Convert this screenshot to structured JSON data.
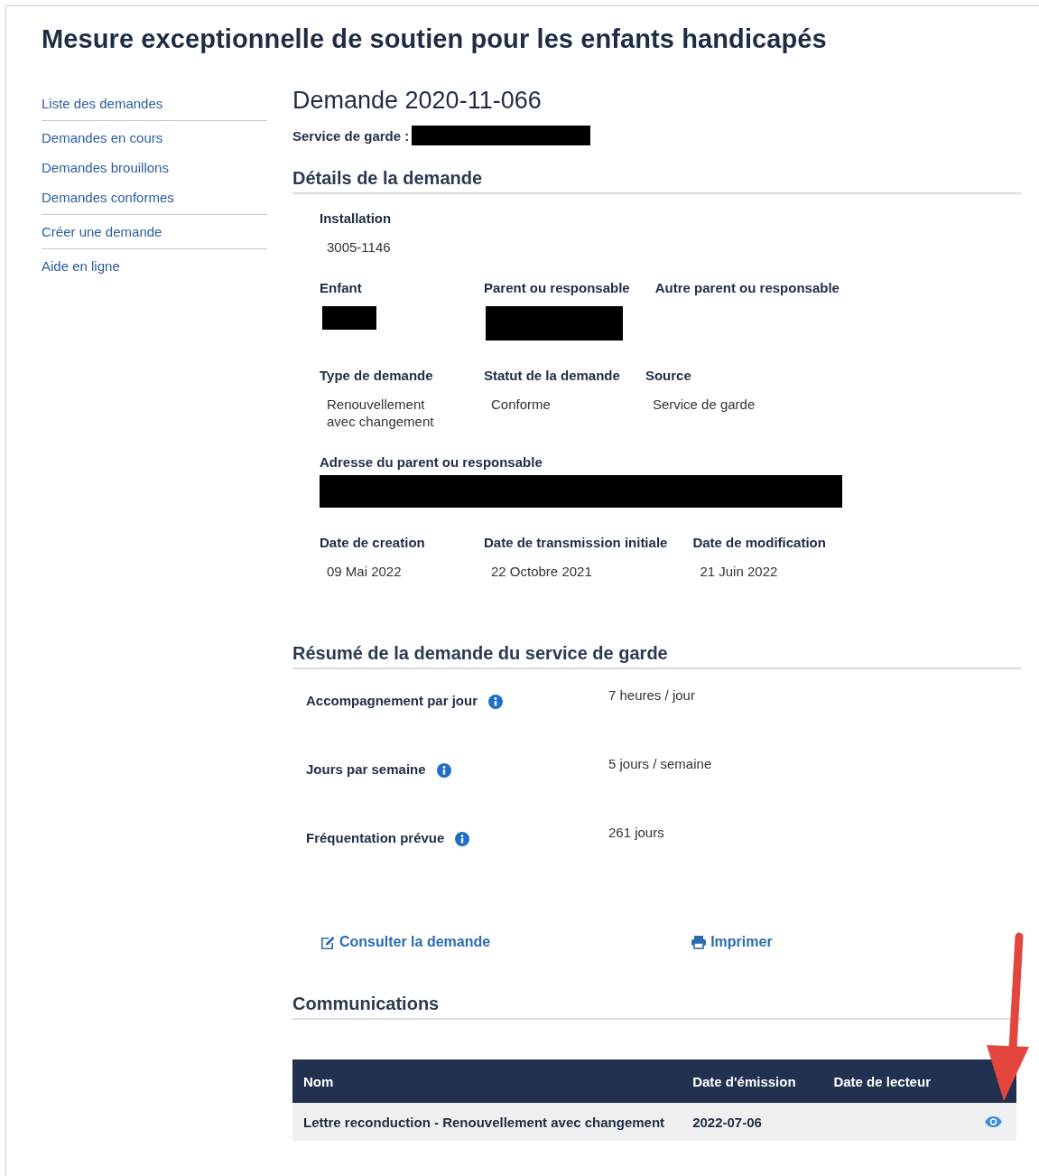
{
  "page_title": "Mesure exceptionnelle de soutien pour les enfants handicapés",
  "sidebar": {
    "groups": [
      [
        "Liste des demandes"
      ],
      [
        "Demandes en cours",
        "Demandes brouillons",
        "Demandes conformes"
      ],
      [
        "Créer une demande"
      ],
      [
        "Aide en ligne"
      ]
    ]
  },
  "request": {
    "title": "Demande 2020-11-066",
    "service": {
      "label": "Service de garde :",
      "kind": "redacted"
    }
  },
  "details": {
    "heading": "Détails de la demande",
    "rows": [
      [
        {
          "kind": "text",
          "label": "Installation",
          "value": "3005-1146"
        }
      ],
      [
        {
          "kind": "redacted",
          "label": "Enfant"
        },
        {
          "kind": "redacted",
          "label": "Parent ou responsable"
        },
        {
          "kind": "blank",
          "label": "Autre parent ou responsable"
        }
      ],
      [
        {
          "kind": "text",
          "label": "Type de demande",
          "value": "Renouvellement\navec changement"
        },
        {
          "kind": "text",
          "label": "Statut de la demande",
          "value": "Conforme"
        },
        {
          "kind": "text",
          "label": "Source",
          "value": "Service de garde"
        }
      ],
      [
        {
          "kind": "redacted",
          "label": "Adresse du parent ou responsable"
        }
      ],
      [
        {
          "kind": "text",
          "label": "Date de creation",
          "value": "09 Mai 2022"
        },
        {
          "kind": "text",
          "label": "Date de transmission initiale",
          "value": "22 Octobre 2021"
        },
        {
          "kind": "text",
          "label": "Date de modification",
          "value": "21 Juin 2022"
        }
      ]
    ]
  },
  "summary": {
    "heading": "Résumé de la demande du service de garde",
    "rows": [
      {
        "label": "Accompagnement par jour",
        "value": "7 heures / jour"
      },
      {
        "label": "Jours par semaine",
        "value": "5 jours / semaine"
      },
      {
        "label": "Fréquentation prévue",
        "value": "261 jours"
      }
    ]
  },
  "actions": [
    {
      "kind": "edit",
      "label": "Consulter la demande"
    },
    {
      "kind": "print",
      "label": "Imprimer"
    }
  ],
  "communications": {
    "heading": "Communications",
    "columns": [
      "Nom",
      "Date d'émission",
      "Date de lecteur"
    ],
    "rows": [
      {
        "name": "Lettre reconduction - Renouvellement avec changement",
        "date_emission": "2022-07-06"
      }
    ]
  }
}
